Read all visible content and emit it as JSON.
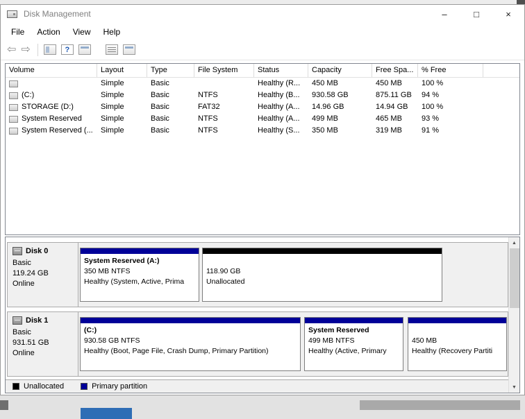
{
  "window_chrome": {
    "title": "Disk Management",
    "controls": {
      "minimize": "–",
      "maximize": "□",
      "close": "×"
    }
  },
  "menu": {
    "items": [
      {
        "label": "File"
      },
      {
        "label": "Action"
      },
      {
        "label": "View"
      },
      {
        "label": "Help"
      }
    ]
  },
  "toolbar": {
    "back_glyph": "⇦",
    "forward_glyph": "⇨",
    "help_glyph": "?"
  },
  "volume_table": {
    "columns": [
      "Volume",
      "Layout",
      "Type",
      "File System",
      "Status",
      "Capacity",
      "Free Spa...",
      "% Free"
    ],
    "rows": [
      {
        "volume": "",
        "layout": "Simple",
        "type": "Basic",
        "file_system": "",
        "status": "Healthy (R...",
        "capacity": "450 MB",
        "free_space": "450 MB",
        "pct_free": "100 %"
      },
      {
        "volume": "(C:)",
        "layout": "Simple",
        "type": "Basic",
        "file_system": "NTFS",
        "status": "Healthy (B...",
        "capacity": "930.58 GB",
        "free_space": "875.11 GB",
        "pct_free": "94 %"
      },
      {
        "volume": "STORAGE (D:)",
        "layout": "Simple",
        "type": "Basic",
        "file_system": "FAT32",
        "status": "Healthy (A...",
        "capacity": "14.96 GB",
        "free_space": "14.94 GB",
        "pct_free": "100 %"
      },
      {
        "volume": "System Reserved",
        "layout": "Simple",
        "type": "Basic",
        "file_system": "NTFS",
        "status": "Healthy (A...",
        "capacity": "499 MB",
        "free_space": "465 MB",
        "pct_free": "93 %"
      },
      {
        "volume": "System Reserved (...",
        "layout": "Simple",
        "type": "Basic",
        "file_system": "NTFS",
        "status": "Healthy (S...",
        "capacity": "350 MB",
        "free_space": "319 MB",
        "pct_free": "91 %"
      }
    ]
  },
  "disks": [
    {
      "name": "Disk 0",
      "kind": "Basic",
      "size": "119.24 GB",
      "status": "Online",
      "partitions": [
        {
          "title": "System Reserved (A:)",
          "line2": "350 MB NTFS",
          "line3": "Healthy (System, Active, Prima",
          "bar_color": "#000098"
        },
        {
          "title": "",
          "line2": "118.90 GB",
          "line3": "Unallocated",
          "bar_color": "#000000"
        }
      ]
    },
    {
      "name": "Disk 1",
      "kind": "Basic",
      "size": "931.51 GB",
      "status": "Online",
      "partitions": [
        {
          "title": "(C:)",
          "line2": "930.58 GB NTFS",
          "line3": "Healthy (Boot, Page File, Crash Dump, Primary Partition)",
          "bar_color": "#000098"
        },
        {
          "title": "System Reserved",
          "line2": "499 MB NTFS",
          "line3": "Healthy (Active, Primary",
          "bar_color": "#000098"
        },
        {
          "title": "",
          "line2": "450 MB",
          "line3": "Healthy (Recovery Partiti",
          "bar_color": "#000098"
        }
      ]
    }
  ],
  "legend": {
    "items": [
      {
        "label": "Unallocated",
        "color": "#000000"
      },
      {
        "label": "Primary partition",
        "color": "#000098"
      }
    ]
  },
  "scrollbar": {
    "up": "▲",
    "down": "▼"
  },
  "colors": {
    "primary_partition": "#000098",
    "unallocated": "#000000"
  }
}
